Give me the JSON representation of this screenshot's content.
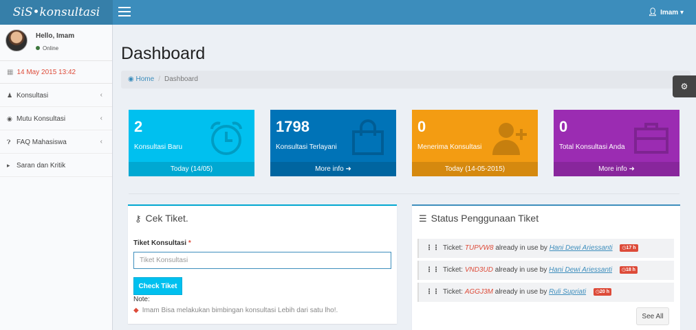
{
  "header": {
    "logo": "SiS•konsultasi",
    "user_name": "Imam"
  },
  "sidebar": {
    "greeting": "Hello, Imam",
    "status": "Online",
    "date": "14 May 2015 13:42",
    "items": [
      {
        "label": "Konsultasi",
        "icon": "users-icon",
        "has_children": true
      },
      {
        "label": "Mutu Konsultasi",
        "icon": "dashboard-icon",
        "has_children": true
      },
      {
        "label": "FAQ Mahasiswa",
        "icon": "question-icon",
        "has_children": true
      },
      {
        "label": "Saran dan Kritik",
        "icon": "bullhorn-icon",
        "has_children": false
      }
    ]
  },
  "page": {
    "title": "Dashboard",
    "breadcrumb": {
      "home": "Home",
      "current": "Dashboard"
    }
  },
  "stats": [
    {
      "number": "2",
      "label": "Konsultasi Baru",
      "footer": "Today (14/05)",
      "color": "#00c0ef",
      "icon": "alarm-clock-icon"
    },
    {
      "number": "1798",
      "label": "Konsultasi Terlayani",
      "footer": "More info",
      "color": "#0073b7",
      "icon": "shopping-bag-icon"
    },
    {
      "number": "0",
      "label": "Menerima Konsultasi",
      "footer": "Today (14-05-2015)",
      "color": "#f39c12",
      "icon": "person-add-icon"
    },
    {
      "number": "0",
      "label": "Total Konsultasi Anda",
      "footer": "More info",
      "color": "#9b2cb2",
      "icon": "briefcase-icon"
    }
  ],
  "cek_tiket": {
    "title": "Cek Tiket.",
    "field_label": "Tiket Konsultasi",
    "required_mark": "*",
    "placeholder": "Tiket Konsultasi",
    "button": "Check Tiket",
    "note_label": "Note:",
    "note_text": "Imam Bisa melakukan bimbingan konsultasi Lebih dari satu lho!."
  },
  "status_tiket": {
    "title": "Status Penggunaan Tiket",
    "prefix": "Ticket:",
    "middle": "already in use by",
    "rows": [
      {
        "code": "TUPVW8",
        "user": "Hani Dewi Ariessanti",
        "age": "17 h"
      },
      {
        "code": "VND3UD",
        "user": "Hani Dewi Ariessanti",
        "age": "18 h"
      },
      {
        "code": "AGGJ3M",
        "user": "Ruli Supriati",
        "age": "20 h"
      }
    ],
    "see_all": "See All"
  }
}
